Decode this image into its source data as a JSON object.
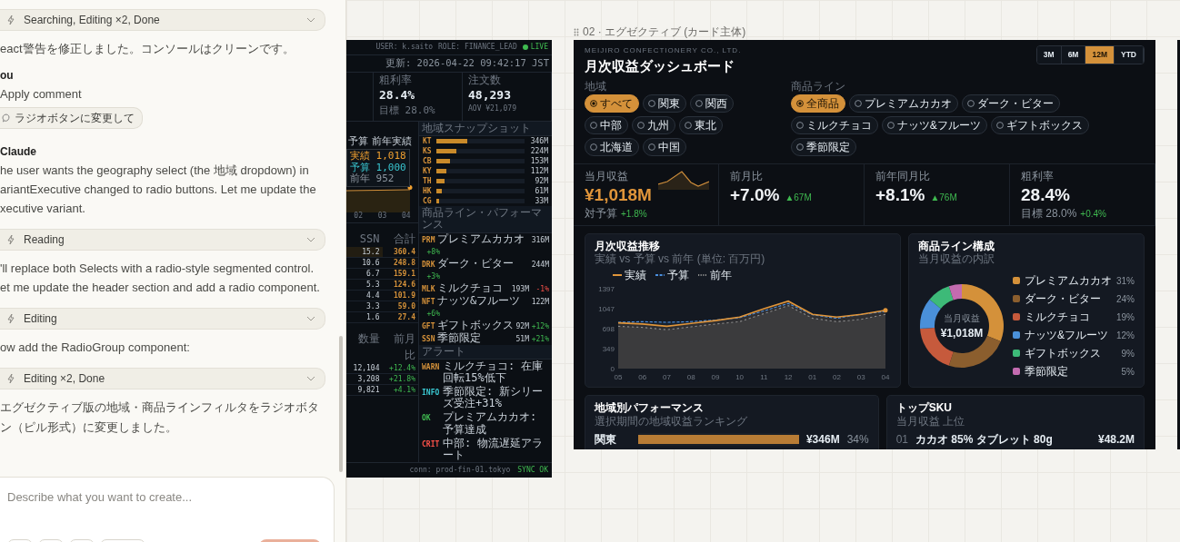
{
  "chat": {
    "items": [
      {
        "kind": "tool",
        "text": "Searching, Editing ×2, Done"
      },
      {
        "kind": "text",
        "text": "eact警告を修正しました。コンソールはクリーンです。"
      },
      {
        "kind": "author",
        "text": "ou"
      },
      {
        "kind": "text",
        "text": "Apply comment"
      },
      {
        "kind": "chip",
        "text": "ラジオボタンに変更して"
      },
      {
        "kind": "author",
        "text": "Claude"
      },
      {
        "kind": "text",
        "text": "he user wants the geography select (the 地域 dropdown) in\nariantExecutive changed to radio buttons. Let me update the\nxecutive variant."
      },
      {
        "kind": "tool",
        "text": "Reading"
      },
      {
        "kind": "text",
        "text": "'ll replace both Selects with a radio-style segmented control.\net me update the header section and add a radio component."
      },
      {
        "kind": "tool",
        "text": "Editing"
      },
      {
        "kind": "text",
        "text": "ow add the RadioGroup component:"
      },
      {
        "kind": "tool",
        "text": "Editing ×2, Done"
      },
      {
        "kind": "text",
        "text": "エグゼクティブ版の地域・商品ラインフィルタをラジオボタン（ピル形式）に変更しました。"
      }
    ]
  },
  "composer": {
    "placeholder": "Describe what you want to create..."
  },
  "terminal": {
    "user": "USER: k.saito",
    "role": "ROLE: FINANCE_LEAD",
    "live": "LIVE",
    "updated": "更新: 2026-04-22 09:42:17 JST",
    "kpis": [
      {
        "label": "粗利率",
        "value": "28.4%",
        "sub": "目標 28.0%"
      },
      {
        "label": "注文数",
        "value": "48,293",
        "sub": "AOV ¥21,079"
      }
    ],
    "chart": {
      "legend": [
        "予算",
        "前年実績"
      ],
      "tooltip": [
        "実績 1,018",
        "予算 1,000",
        "前年 952"
      ],
      "x_labels": [
        "02",
        "03",
        "04"
      ]
    },
    "table": {
      "columns": [
        "SSN",
        "合計"
      ],
      "rows": [
        [
          "15.2",
          "360.4"
        ],
        [
          "10.6",
          "248.8"
        ],
        [
          "6.7",
          "159.1"
        ],
        [
          "5.3",
          "124.6"
        ],
        [
          "4.4",
          "101.9"
        ],
        [
          "3.3",
          "59.0"
        ],
        [
          "1.6",
          "27.4"
        ]
      ]
    },
    "table2": {
      "columns": [
        "数量",
        "前月比"
      ],
      "rows": [
        [
          "12,104",
          "+12.4%"
        ],
        [
          "3,208",
          "+21.8%"
        ],
        [
          "9,821",
          "+4.1%"
        ]
      ]
    },
    "regions": {
      "title": "地域スナップショット",
      "items": [
        {
          "code": "KT",
          "level": 0.35,
          "value": "346M"
        },
        {
          "code": "KS",
          "level": 0.23,
          "value": "224M"
        },
        {
          "code": "CB",
          "level": 0.15,
          "value": "153M"
        },
        {
          "code": "KY",
          "level": 0.11,
          "value": "112M"
        },
        {
          "code": "TH",
          "level": 0.09,
          "value": "92M"
        },
        {
          "code": "HK",
          "level": 0.06,
          "value": "61M"
        },
        {
          "code": "CG",
          "level": 0.03,
          "value": "33M"
        }
      ]
    },
    "products": {
      "title": "商品ライン・パフォーマンス",
      "items": [
        {
          "code": "PRM",
          "name": "プレミアムカカオ",
          "value": "316M",
          "change": "+8%",
          "negative": false
        },
        {
          "code": "DRK",
          "name": "ダーク・ビター",
          "value": "244M",
          "change": "+3%",
          "negative": false
        },
        {
          "code": "MLK",
          "name": "ミルクチョコ",
          "value": "193M",
          "change": "-1%",
          "negative": true
        },
        {
          "code": "NFT",
          "name": "ナッツ&フルーツ",
          "value": "122M",
          "change": "+6%",
          "negative": false
        },
        {
          "code": "GFT",
          "name": "ギフトボックス",
          "value": "92M",
          "change": "+12%",
          "negative": false
        },
        {
          "code": "SSN",
          "name": "季節限定",
          "value": "51M",
          "change": "+21%",
          "negative": false
        }
      ]
    },
    "alerts": {
      "title": "アラート",
      "items": [
        {
          "kind": "warn",
          "tag": "WARN",
          "text": "ミルクチョコ: 在庫回転15%低下"
        },
        {
          "kind": "info",
          "tag": "INFO",
          "text": "季節限定: 新シリーズ受注+31%"
        },
        {
          "kind": "ok",
          "tag": "OK",
          "text": "プレミアムカカオ: 予算達成"
        },
        {
          "kind": "crit",
          "tag": "CRIT",
          "text": "中部: 物流遅延アラート"
        }
      ]
    },
    "footer": {
      "conn": "conn: prod-fin-01.tokyo",
      "sync": "SYNC OK"
    }
  },
  "executive": {
    "label": "02 · エグゼクティブ (カード主体)",
    "company": "MEIJIRO CONFECTIONERY CO., LTD.",
    "title": "月次収益ダッシュボード",
    "ranges": [
      {
        "label": "3M",
        "selected": false
      },
      {
        "label": "6M",
        "selected": false
      },
      {
        "label": "12M",
        "selected": true
      },
      {
        "label": "YTD",
        "selected": false
      }
    ],
    "region_filter": {
      "label": "地域",
      "options": [
        {
          "label": "すべて",
          "selected": true
        },
        {
          "label": "関東",
          "selected": false
        },
        {
          "label": "関西",
          "selected": false
        },
        {
          "label": "中部",
          "selected": false
        },
        {
          "label": "九州",
          "selected": false
        },
        {
          "label": "東北",
          "selected": false
        },
        {
          "label": "北海道",
          "selected": false
        },
        {
          "label": "中国",
          "selected": false
        }
      ]
    },
    "product_filter": {
      "label": "商品ライン",
      "options": [
        {
          "label": "全商品",
          "selected": true
        },
        {
          "label": "プレミアムカカオ",
          "selected": false
        },
        {
          "label": "ダーク・ビター",
          "selected": false
        },
        {
          "label": "ミルクチョコ",
          "selected": false
        },
        {
          "label": "ナッツ&フルーツ",
          "selected": false
        },
        {
          "label": "ギフトボックス",
          "selected": false
        },
        {
          "label": "季節限定",
          "selected": false
        }
      ]
    },
    "kpis": [
      {
        "kind": "spark",
        "label": "当月収益",
        "value": "¥1,018M",
        "accent": true,
        "sub_label": "対予算",
        "sub_value": "+1.8%"
      },
      {
        "kind": "delta",
        "label": "前月比",
        "value": "+7.0%",
        "accent": false,
        "delta": "▲67M"
      },
      {
        "kind": "delta",
        "label": "前年同月比",
        "value": "+8.1%",
        "accent": false,
        "delta": "▲76M"
      },
      {
        "kind": "target",
        "label": "粗利率",
        "value": "28.4%",
        "accent": false,
        "sub_label": "目標 28.0%",
        "sub_value": "+0.4%"
      }
    ],
    "trend_card": {
      "title": "月次収益推移",
      "subtitle": "実績 vs 予算 vs 前年 (単位: 百万円)",
      "chart_data": {
        "type": "area",
        "categories": [
          "05",
          "06",
          "07",
          "08",
          "09",
          "10",
          "11",
          "12",
          "01",
          "02",
          "03",
          "04"
        ],
        "series": [
          {
            "name": "実績",
            "color": "#e0953a",
            "line_style": "solid",
            "values": [
              800,
              780,
              740,
              790,
              840,
              900,
              1050,
              1180,
              950,
              900,
              950,
              1020
            ]
          },
          {
            "name": "予算",
            "color": "#4a8fe0",
            "line_style": "dashed",
            "values": [
              810,
              820,
              810,
              820,
              850,
              890,
              1010,
              1140,
              940,
              880,
              950,
              1000
            ]
          },
          {
            "name": "前年",
            "color": "#8a8a8a",
            "line_style": "dotted",
            "values": [
              740,
              720,
              680,
              730,
              780,
              820,
              960,
              1100,
              880,
              820,
              860,
              950
            ]
          }
        ],
        "ylim": [
          0,
          1397
        ],
        "yticks": [
          0,
          349,
          698,
          1047,
          1397
        ]
      }
    },
    "mix_card": {
      "title": "商品ライン構成",
      "subtitle": "当月収益の内訳",
      "center_label": "当月収益",
      "center_value": "¥1,018M",
      "legend": [
        {
          "share": "31%",
          "color": "#d4913a"
        },
        {
          "share": "24%",
          "color": "#8b5e2e"
        },
        {
          "share": "19%",
          "color": "#c65a3c"
        },
        {
          "share": "12%",
          "color": "#4a90d9"
        },
        {
          "share": "9%",
          "color": "#3dba78"
        },
        {
          "share": "5%",
          "color": "#c36bb0"
        }
      ],
      "chart_data": {
        "type": "donut",
        "categories": [
          "プレミアムカカオ",
          "ダーク・ビター",
          "ミルクチョコ",
          "ナッツ&フルーツ",
          "ギフトボックス",
          "季節限定"
        ],
        "values": [
          31,
          24,
          19,
          12,
          9,
          5
        ]
      }
    },
    "region_card": {
      "title": "地域別パフォーマンス",
      "subtitle": "選択期間の地域収益ランキング",
      "rows": [
        {
          "name": "関東",
          "level": 1,
          "value": "¥346M",
          "share": "34%"
        }
      ]
    },
    "sku_card": {
      "title": "トップSKU",
      "subtitle": "当月収益 上位",
      "rows": [
        {
          "rank": "01",
          "name": "カカオ 85% タブレット 80g",
          "value": "¥48.2M"
        }
      ]
    }
  }
}
